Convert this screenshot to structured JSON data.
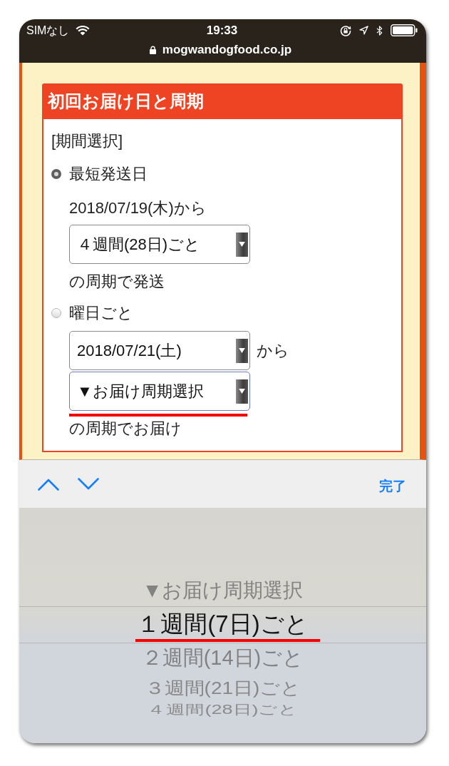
{
  "status_bar": {
    "carrier": "SIMなし",
    "time": "19:33",
    "url": "mogwandogfood.co.jp"
  },
  "card": {
    "title": "初回お届け日と周期",
    "section_label": "[期間選択]",
    "options": [
      {
        "label": "最短発送日",
        "selected": true,
        "rows": [
          {
            "kind": "text",
            "text": "2018/07/19(木)から"
          },
          {
            "kind": "select",
            "value": "４週間(28日)ごと",
            "focused": false
          },
          {
            "kind": "text",
            "text": "の周期で発送"
          }
        ]
      },
      {
        "label": "曜日ごと",
        "selected": false,
        "rows": [
          {
            "kind": "select",
            "value": "2018/07/21(土)",
            "suffix": "から",
            "focused": false
          },
          {
            "kind": "select",
            "value": "▼お届け周期選択",
            "focused": true,
            "highlighted": true
          },
          {
            "kind": "text",
            "text": "の周期でお届け"
          }
        ]
      }
    ]
  },
  "toolbar": {
    "done": "完了"
  },
  "picker": {
    "options": [
      {
        "label": "▼お届け周期選択",
        "selected": false,
        "highlighted": false
      },
      {
        "label": "１週間(7日)ごと",
        "selected": true,
        "highlighted": true
      },
      {
        "label": "２週間(14日)ごと",
        "selected": false,
        "highlighted": false
      },
      {
        "label": "３週間(21日)ごと",
        "selected": false,
        "highlighted": false
      },
      {
        "label": "４週間(28日)ごと",
        "selected": false,
        "highlighted": false
      }
    ]
  }
}
